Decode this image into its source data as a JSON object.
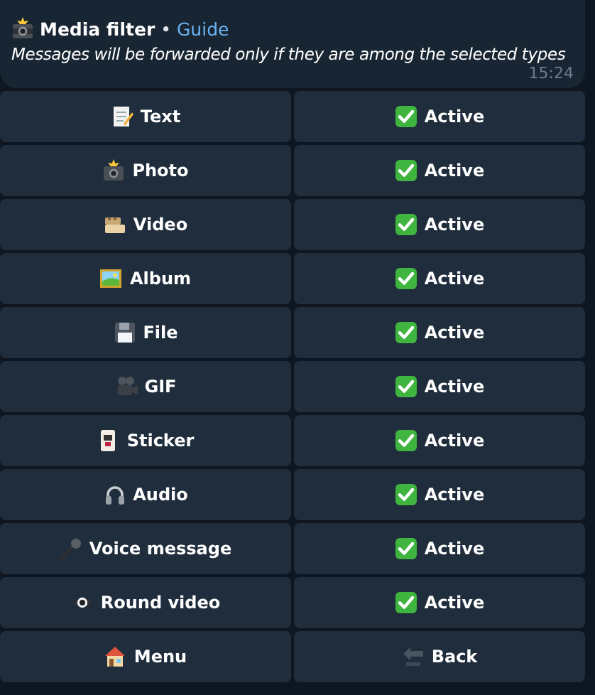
{
  "message": {
    "title": "Media filter",
    "separator": "•",
    "link": "Guide",
    "text": "Messages will be forwarded only if they are among the selected types",
    "time": "15:24"
  },
  "keyboard": [
    {
      "left": {
        "kind": "text",
        "label": "Text"
      },
      "right": {
        "kind": "status",
        "label": "Active",
        "active": true
      }
    },
    {
      "left": {
        "kind": "photo",
        "label": "Photo"
      },
      "right": {
        "kind": "status",
        "label": "Active",
        "active": true
      }
    },
    {
      "left": {
        "kind": "video",
        "label": "Video"
      },
      "right": {
        "kind": "status",
        "label": "Active",
        "active": true
      }
    },
    {
      "left": {
        "kind": "album",
        "label": "Album"
      },
      "right": {
        "kind": "status",
        "label": "Active",
        "active": true
      }
    },
    {
      "left": {
        "kind": "file",
        "label": "File"
      },
      "right": {
        "kind": "status",
        "label": "Active",
        "active": true
      }
    },
    {
      "left": {
        "kind": "gif",
        "label": "GIF"
      },
      "right": {
        "kind": "status",
        "label": "Active",
        "active": true
      }
    },
    {
      "left": {
        "kind": "sticker",
        "label": "Sticker"
      },
      "right": {
        "kind": "status",
        "label": "Active",
        "active": true
      }
    },
    {
      "left": {
        "kind": "audio",
        "label": "Audio"
      },
      "right": {
        "kind": "status",
        "label": "Active",
        "active": true
      }
    },
    {
      "left": {
        "kind": "voice",
        "label": "Voice message"
      },
      "right": {
        "kind": "status",
        "label": "Active",
        "active": true
      }
    },
    {
      "left": {
        "kind": "round_video",
        "label": "Round video"
      },
      "right": {
        "kind": "status",
        "label": "Active",
        "active": true
      }
    },
    {
      "left": {
        "kind": "menu",
        "label": "Menu"
      },
      "right": {
        "kind": "back",
        "label": "Back"
      }
    }
  ]
}
